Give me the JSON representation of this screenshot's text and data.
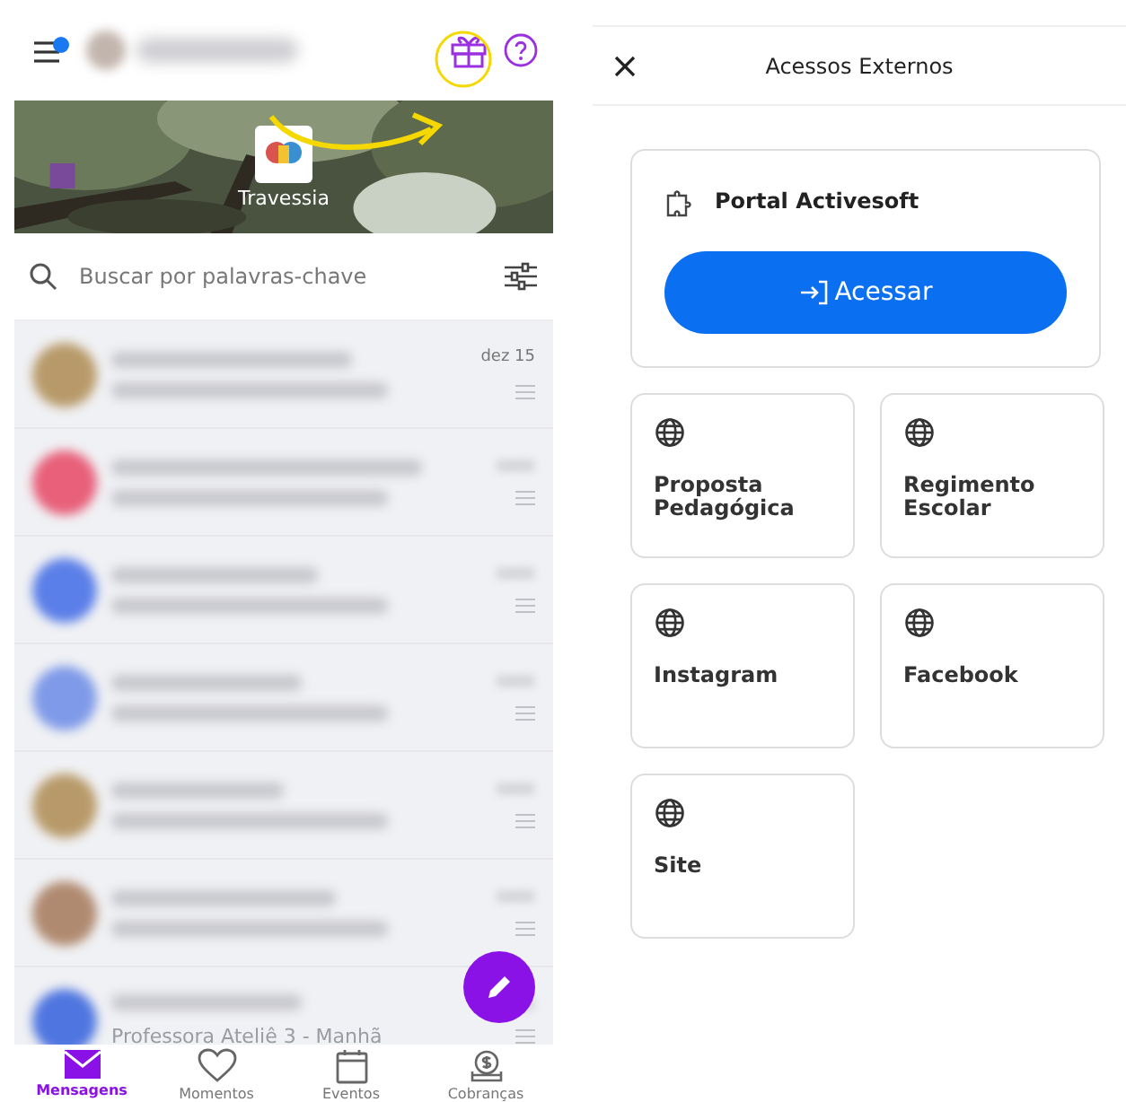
{
  "messages_screen": {
    "school_name": "Travessia",
    "search": {
      "placeholder": "Buscar por palavras-chave"
    },
    "messages": [
      {
        "color": "#b89a6a",
        "time": "dez 15"
      },
      {
        "color": "#e8607a"
      },
      {
        "color": "#5b7fe8"
      },
      {
        "color": "#7f9ae8"
      },
      {
        "color": "#b89a6a"
      },
      {
        "color": "#b08a70"
      },
      {
        "color": "#4f76e0",
        "subtitle": "Professora Ateliê 3 - Manhã"
      }
    ],
    "nav": [
      {
        "label": "Mensagens",
        "selected": true
      },
      {
        "label": "Momentos",
        "selected": false
      },
      {
        "label": "Eventos",
        "selected": false
      },
      {
        "label": "Cobranças",
        "selected": false
      }
    ]
  },
  "access_screen": {
    "title": "Acessos Externos",
    "portal": {
      "name": "Portal Activesoft",
      "button": "Acessar"
    },
    "links": [
      {
        "label": "Proposta Pedagógica"
      },
      {
        "label": "Regimento Escolar"
      },
      {
        "label": "Instagram"
      },
      {
        "label": "Facebook"
      },
      {
        "label": "Site"
      }
    ]
  }
}
